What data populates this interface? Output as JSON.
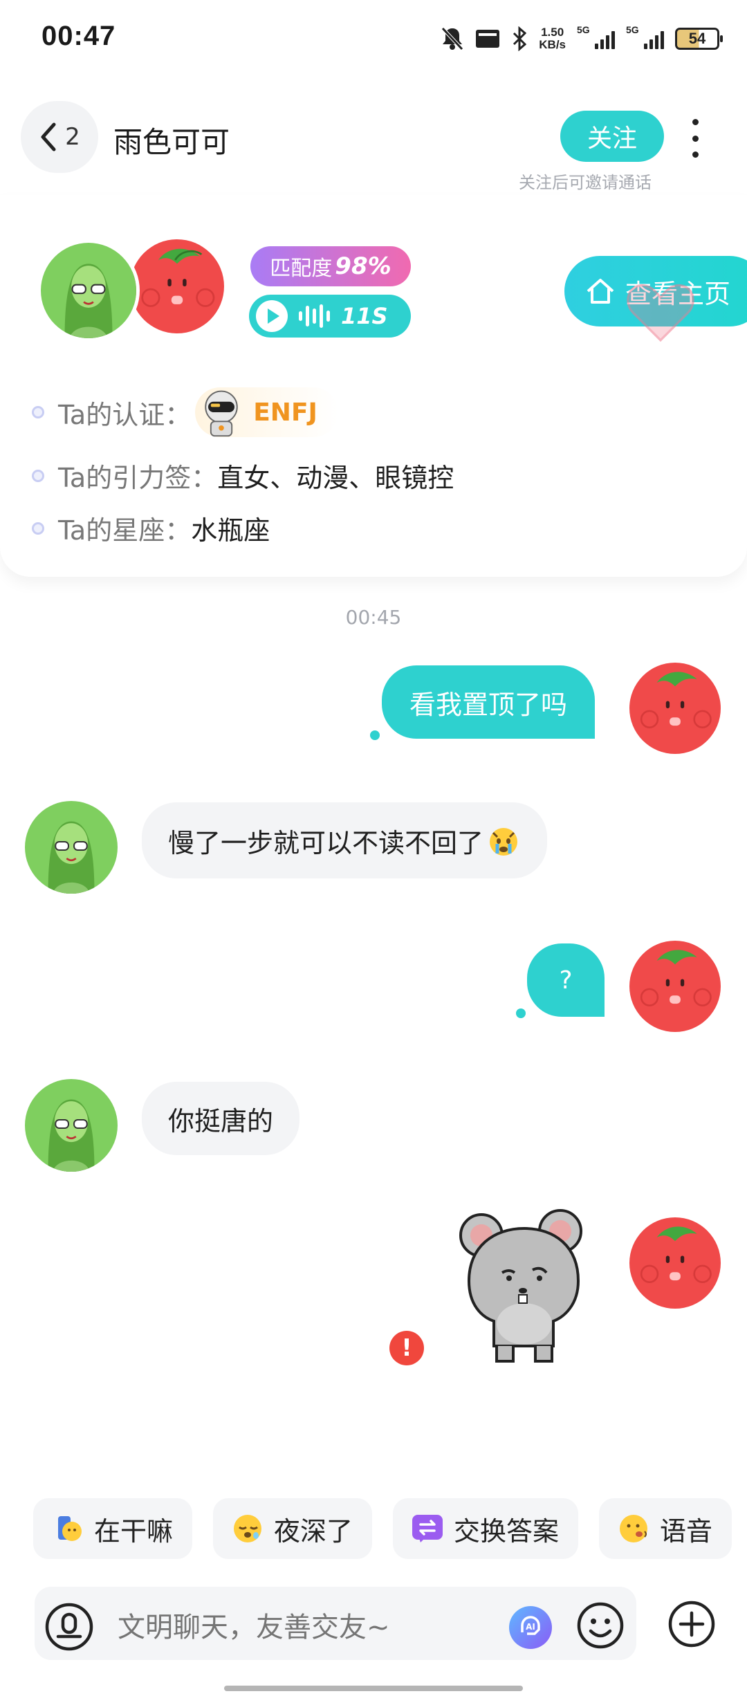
{
  "status_bar": {
    "time": "00:47",
    "net_speed_value": "1.50",
    "net_speed_unit": "KB/s",
    "signal_1": "5G",
    "signal_2": "5G",
    "battery": "54"
  },
  "header": {
    "unread_count": "2",
    "title": "雨色可可",
    "follow_label": "关注",
    "follow_hint": "关注后可邀请通话"
  },
  "profile": {
    "match_label": "匹配度",
    "match_value": "98%",
    "voice_duration": "11S",
    "homepage_label": "查看主页",
    "cert_label": "Ta的认证：",
    "mbti": "ENFJ",
    "tags_label": "Ta的引力签：",
    "tags_value": "直女、动漫、眼镜控",
    "zodiac_label": "Ta的星座：",
    "zodiac_value": "水瓶座"
  },
  "chat": {
    "timestamp": "00:45",
    "messages": [
      {
        "from": "me",
        "text": "看我置顶了吗"
      },
      {
        "from": "them",
        "text": "慢了一步就可以不读不回了"
      },
      {
        "from": "me",
        "text": "?"
      },
      {
        "from": "them",
        "text": "你挺唐的"
      },
      {
        "from": "me",
        "type": "sticker",
        "sticker": "gray-mouse",
        "status": "failed",
        "status_symbol": "!"
      }
    ]
  },
  "quick_replies": [
    {
      "label": "在干嘛",
      "icon": "phone-face-emoji"
    },
    {
      "label": "夜深了",
      "icon": "sleepy-emoji"
    },
    {
      "label": "交换答案",
      "icon": "exchange-icon"
    },
    {
      "label": "语音",
      "icon": "voice-face-emoji"
    }
  ],
  "input": {
    "placeholder": "文明聊天，友善交友~"
  },
  "colors": {
    "accent": "#2ed1cf",
    "bubble_in": "#f3f4f6",
    "error": "#f0473d",
    "match_gradient_start": "#a97cf5",
    "match_gradient_end": "#f06ab0"
  }
}
